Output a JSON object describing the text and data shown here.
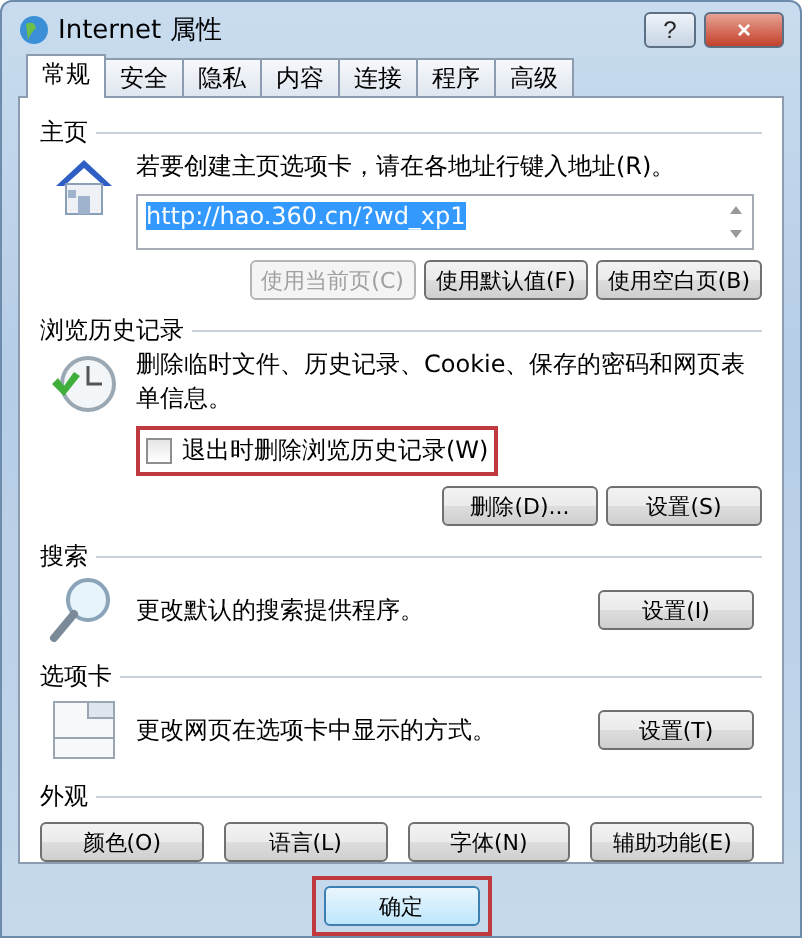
{
  "window": {
    "title": "Internet 属性"
  },
  "title_buttons": [
    {
      "kind": "help",
      "label": "?"
    },
    {
      "kind": "close",
      "label": "×"
    }
  ],
  "tabs": [
    {
      "label": "常规",
      "selected": true
    },
    {
      "label": "安全",
      "selected": false
    },
    {
      "label": "隐私",
      "selected": false
    },
    {
      "label": "内容",
      "selected": false
    },
    {
      "label": "连接",
      "selected": false
    },
    {
      "label": "程序",
      "selected": false
    },
    {
      "label": "高级",
      "selected": false
    }
  ],
  "sections": [
    {
      "kind": "home",
      "title": "主页",
      "description": "若要创建主页选项卡，请在各地址行键入地址(R)。",
      "url": {
        "value": "http://hao.360.cn/?wd_xp1",
        "selected": true
      },
      "buttons": [
        {
          "label": "使用当前页(C)",
          "disabled": true
        },
        {
          "label": "使用默认值(F)",
          "disabled": false
        },
        {
          "label": "使用空白页(B)",
          "disabled": false
        }
      ]
    },
    {
      "kind": "history",
      "title": "浏览历史记录",
      "description": "删除临时文件、历史记录、Cookie、保存的密码和网页表单信息。",
      "checkbox": {
        "label": "退出时删除浏览历史记录(W)",
        "checked": false,
        "highlighted": true
      },
      "buttons": [
        {
          "label": "删除(D)...",
          "disabled": false
        },
        {
          "label": "设置(S)",
          "disabled": false
        }
      ]
    },
    {
      "kind": "search",
      "title": "搜索",
      "description": "更改默认的搜索提供程序。",
      "buttons": [
        {
          "label": "设置(I)",
          "disabled": false
        }
      ]
    },
    {
      "kind": "tabs",
      "title": "选项卡",
      "description": "更改网页在选项卡中显示的方式。",
      "buttons": [
        {
          "label": "设置(T)",
          "disabled": false
        }
      ]
    },
    {
      "kind": "appearance",
      "title": "外观",
      "buttons": [
        {
          "label": "颜色(O)",
          "disabled": false
        },
        {
          "label": "语言(L)",
          "disabled": false
        },
        {
          "label": "字体(N)",
          "disabled": false
        },
        {
          "label": "辅助功能(E)",
          "disabled": false
        }
      ]
    }
  ],
  "footer_buttons": [
    {
      "label": "确定",
      "highlighted": true
    }
  ]
}
